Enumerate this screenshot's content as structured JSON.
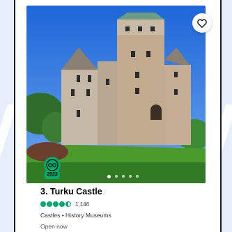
{
  "listing": {
    "title": "3. Turku Castle",
    "rating": 4.5,
    "review_count": "1,146",
    "category": "Castles • History Museums",
    "status": "Open now",
    "badge_year": "2022",
    "favorite_icon": "heart-icon",
    "carousel": {
      "total": 5,
      "active_index": 0
    }
  },
  "colors": {
    "rating_green": "#00aa6c",
    "badge_green": "#00aa6c",
    "page_background": "#e6eefb"
  }
}
